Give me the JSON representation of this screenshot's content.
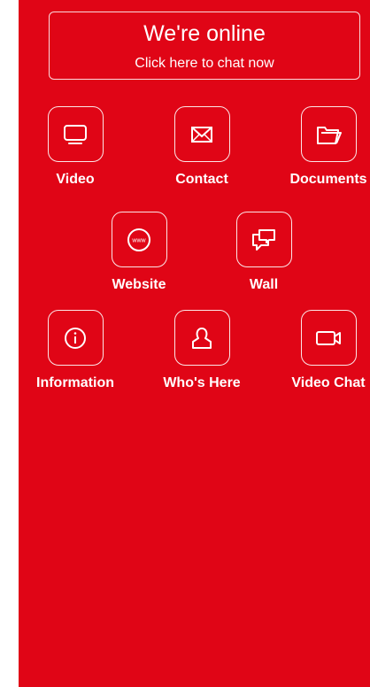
{
  "colors": {
    "panel_background": "#e00516",
    "foreground": "#ffffff"
  },
  "chat_banner": {
    "title": "We're online",
    "subtitle": "Click here to chat now"
  },
  "tiles": [
    {
      "label": "Video",
      "icon": "monitor-icon"
    },
    {
      "label": "Contact",
      "icon": "envelope-icon"
    },
    {
      "label": "Documents",
      "icon": "folder-icon"
    },
    {
      "label": "Website",
      "icon": "www-globe-icon"
    },
    {
      "label": "Wall",
      "icon": "chat-bubbles-icon"
    },
    {
      "label": "Information",
      "icon": "info-icon"
    },
    {
      "label": "Who's Here",
      "icon": "person-icon"
    },
    {
      "label": "Video Chat",
      "icon": "video-camera-icon"
    }
  ],
  "website_icon_text": "www"
}
